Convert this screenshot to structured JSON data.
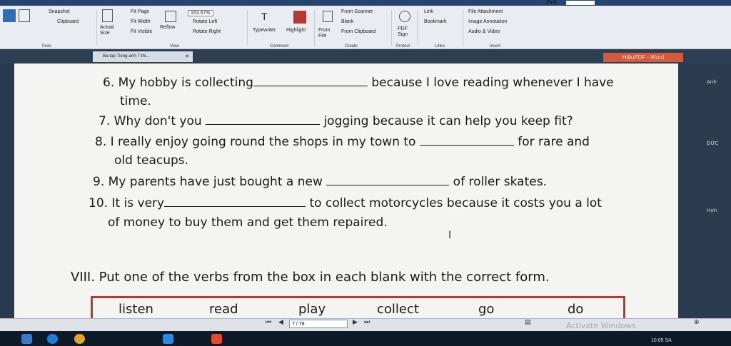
{
  "app": {
    "find_label": "Find",
    "ribbon_groups": [
      "Tools",
      "View",
      "Comment",
      "Create",
      "Protect",
      "Links",
      "Insert"
    ],
    "toolbar": {
      "snapshot": "Snapshot",
      "clipboard": "Clipboard",
      "fit_page": "Fit Page",
      "fit_width": "Fit Width",
      "fit_visible": "Fit Visible",
      "actual_size": "Actual Size",
      "reflow": "Reflow",
      "zoom_value": "163.67%",
      "rotate_left": "Rotate Left",
      "rotate_right": "Rotate Right",
      "typewriter": "Typewriter",
      "highlight": "Highlight",
      "from_file": "From File",
      "from_scanner": "From Scanner",
      "blank": "Blank",
      "from_clipboard": "From Clipboard",
      "pdf_sign": "PDF Sign",
      "link": "Link",
      "bookmark": "Bookmark",
      "file_attachment": "File Attachment",
      "image_annotation": "Image Annotation",
      "audio_video": "Audio & Video"
    },
    "tab_label": "Ba-tap-Tieng-anh-7-thi...",
    "brand_tag": "HiệuPDF - Word",
    "side_texts": [
      "Anh",
      "ĐỨC",
      "Hưn"
    ],
    "page_indicator": "7 / 76",
    "watermark_text": "Activate Windows",
    "clock": "10:05 SA"
  },
  "document": {
    "questions": [
      {
        "num": "6.",
        "before": "My hobby is collecting",
        "after": "because I love reading whenever I have",
        "cont": "time."
      },
      {
        "num": "7.",
        "before": "Why don't you",
        "after": "jogging because it can help you keep fit?"
      },
      {
        "num": "8.",
        "before": "I really enjoy going round the shops in my town to",
        "after": "for rare and",
        "cont": "old teacups."
      },
      {
        "num": "9.",
        "before": "My parents have just bought a new",
        "after": "of roller skates."
      },
      {
        "num": "10.",
        "before": "It is very",
        "after": "to collect motorcycles because it costs you a lot",
        "cont": "of money to buy them and get them repaired."
      }
    ],
    "section_title": "VIII. Put one of the verbs from the box in each blank with the correct form.",
    "verbs": [
      "listen",
      "read",
      "play",
      "collect",
      "go",
      "do"
    ]
  },
  "colors": {
    "accent_red": "#b73a32",
    "tag_orange": "#d35a3c",
    "ribbon_bg": "#e9edf1",
    "page_bg": "#f4f4f2"
  }
}
